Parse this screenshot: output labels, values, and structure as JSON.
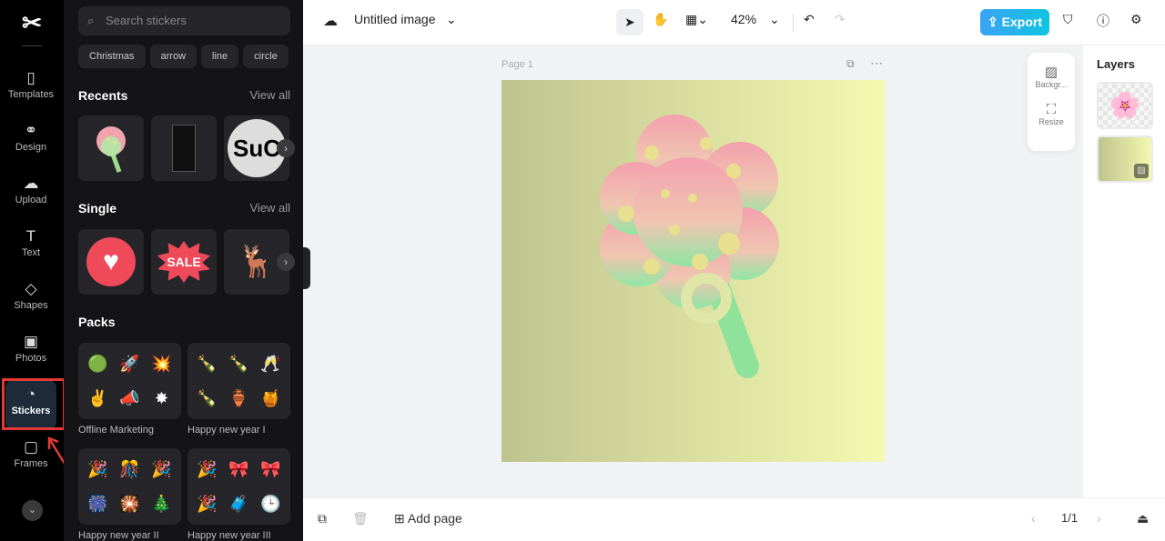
{
  "rail": {
    "items": [
      {
        "label": "Templates",
        "icon": "templates-icon",
        "glyph": "▯"
      },
      {
        "label": "Design",
        "icon": "design-icon",
        "glyph": "⚭"
      },
      {
        "label": "Upload",
        "icon": "upload-icon",
        "glyph": "☁"
      },
      {
        "label": "Text",
        "icon": "text-icon",
        "glyph": "T"
      },
      {
        "label": "Shapes",
        "icon": "shapes-icon",
        "glyph": "◇"
      },
      {
        "label": "Photos",
        "icon": "photos-icon",
        "glyph": "▣"
      },
      {
        "label": "Stickers",
        "icon": "stickers-icon",
        "glyph": "◔"
      },
      {
        "label": "Frames",
        "icon": "frames-icon",
        "glyph": "▢"
      }
    ],
    "active": "Stickers"
  },
  "panel": {
    "search_placeholder": "Search stickers",
    "chips": [
      "Christmas",
      "arrow",
      "line",
      "circle"
    ],
    "recents": {
      "title": "Recents",
      "view_all": "View all"
    },
    "single": {
      "title": "Single",
      "view_all": "View all"
    },
    "packs": {
      "title": "Packs",
      "items": [
        {
          "label": "Offline Marketing",
          "stickers": [
            "🟢",
            "🚀",
            "💥",
            "✌",
            "📣",
            "✸"
          ]
        },
        {
          "label": "Happy new year I",
          "stickers": [
            "🍾",
            "🍾",
            "🥂",
            "🍾",
            "🏺",
            "🍯"
          ]
        },
        {
          "label": "Happy new year II",
          "stickers": [
            "🎉",
            "🎊",
            "🎉",
            "🎆",
            "🎇",
            "🎄"
          ]
        },
        {
          "label": "Happy new year III",
          "stickers": [
            "🎉",
            "🎀",
            "🎀",
            "🎉",
            "🧳",
            "🕒"
          ]
        }
      ]
    },
    "single_stickers": {
      "sale_text": "SALE"
    }
  },
  "topbar": {
    "title": "Untitled image",
    "zoom": "42%",
    "export_label": "Export",
    "accent": "#10c5e0"
  },
  "canvas": {
    "page_label": "Page 1"
  },
  "float_tools": [
    {
      "label": "Backgr..."
    },
    {
      "label": "Resize"
    }
  ],
  "layers": {
    "title": "Layers"
  },
  "bottom": {
    "add_page": "Add page",
    "pagination": "1/1"
  }
}
